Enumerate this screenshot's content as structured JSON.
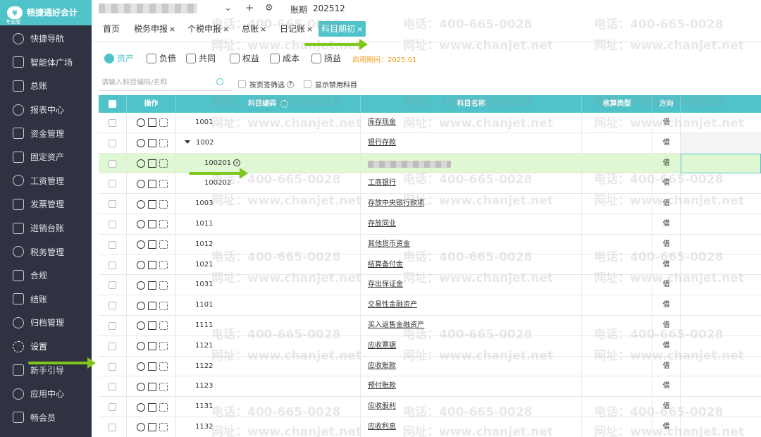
{
  "app": {
    "logo_text": "畅捷通好会计",
    "edition": "专业版"
  },
  "sidebar": {
    "items": [
      {
        "label": "快捷导航",
        "icon": "home-icon"
      },
      {
        "label": "智能体广场",
        "icon": "agent-icon"
      },
      {
        "label": "总账",
        "icon": "ledger-icon"
      },
      {
        "label": "报表中心",
        "icon": "chart-icon"
      },
      {
        "label": "资金管理",
        "icon": "money-icon"
      },
      {
        "label": "固定资产",
        "icon": "asset-icon"
      },
      {
        "label": "工资管理",
        "icon": "salary-icon"
      },
      {
        "label": "发票管理",
        "icon": "invoice-icon"
      },
      {
        "label": "进销台账",
        "icon": "inventory-icon"
      },
      {
        "label": "税务管理",
        "icon": "tax-icon"
      },
      {
        "label": "合规",
        "icon": "shield-icon"
      },
      {
        "label": "结账",
        "icon": "checkout-icon"
      },
      {
        "label": "归档管理",
        "icon": "archive-icon"
      },
      {
        "label": "设置",
        "icon": "gear-icon"
      },
      {
        "label": "新手引导",
        "icon": "guide-icon"
      },
      {
        "label": "应用中心",
        "icon": "app-center-icon"
      },
      {
        "label": "畅会员",
        "icon": "vip-icon"
      }
    ],
    "active_index": 13
  },
  "topbar": {
    "period_label": "账期",
    "period_value": "202512"
  },
  "tabs": [
    {
      "label": "首页",
      "closable": false
    },
    {
      "label": "税务申报",
      "closable": true
    },
    {
      "label": "个税申报",
      "closable": true
    },
    {
      "label": "总账",
      "closable": true
    },
    {
      "label": "日记账",
      "closable": true
    },
    {
      "label": "科目期初",
      "closable": true
    }
  ],
  "active_tab": 5,
  "categories": [
    {
      "label": "资产"
    },
    {
      "label": "负债"
    },
    {
      "label": "共同"
    },
    {
      "label": "权益"
    },
    {
      "label": "成本"
    },
    {
      "label": "损益"
    }
  ],
  "enable_period": "启用期间：2025.01",
  "filters": {
    "search_placeholder": "请输入科目编码/名称",
    "by_tab_filter": "按页签筛选",
    "show_disabled": "显示禁用科目"
  },
  "table": {
    "headers": {
      "ops": "操作",
      "code": "科目编码",
      "name": "科目名称",
      "accounting_type": "核算类型",
      "direction": "方向"
    },
    "rows": [
      {
        "code": "1001",
        "name": "库存现金",
        "direction": "借",
        "level": 1
      },
      {
        "code": "1002",
        "name": "银行存款",
        "direction": "借",
        "level": 1,
        "expanded": true
      },
      {
        "code": "100201",
        "name": "",
        "direction": "借",
        "level": 2,
        "highlighted": true,
        "deletable": true,
        "name_blurred": true
      },
      {
        "code": "100202",
        "name": "工商银行",
        "direction": "借",
        "level": 2
      },
      {
        "code": "1003",
        "name": "存放中央银行款项",
        "direction": "借",
        "level": 1
      },
      {
        "code": "1011",
        "name": "存放同业",
        "direction": "借",
        "level": 1
      },
      {
        "code": "1012",
        "name": "其他货币资金",
        "direction": "借",
        "level": 1
      },
      {
        "code": "1021",
        "name": "结算备付金",
        "direction": "借",
        "level": 1
      },
      {
        "code": "1031",
        "name": "存出保证金",
        "direction": "借",
        "level": 1
      },
      {
        "code": "1101",
        "name": "交易性金融资产",
        "direction": "借",
        "level": 1
      },
      {
        "code": "1111",
        "name": "买入返售金融资产",
        "direction": "借",
        "level": 1
      },
      {
        "code": "1121",
        "name": "应收票据",
        "direction": "借",
        "level": 1
      },
      {
        "code": "1122",
        "name": "应收账款",
        "direction": "借",
        "level": 1
      },
      {
        "code": "1123",
        "name": "预付账款",
        "direction": "借",
        "level": 1
      },
      {
        "code": "1131",
        "name": "应收股利",
        "direction": "借",
        "level": 1
      },
      {
        "code": "1132",
        "name": "应收利息",
        "direction": "借",
        "level": 1
      }
    ]
  },
  "watermark": {
    "phone": "电话：400-665-0028",
    "site": "网址：www.chanjet.net"
  },
  "colors": {
    "accent": "#4fc3c9",
    "sidebar_bg": "#2f3341",
    "highlight_row": "#dff7d2",
    "arrow": "#7fc71d",
    "enable_period": "#f0a020"
  }
}
